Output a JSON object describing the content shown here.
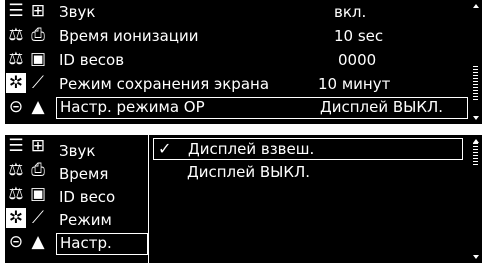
{
  "menu": {
    "items": [
      {
        "label": "Звук",
        "value": "вкл."
      },
      {
        "label": "Время ионизации",
        "value": "10 sec"
      },
      {
        "label": "ID  весов",
        "value": "0000"
      },
      {
        "label": "Режим сохранения экрана",
        "value": "10 минут"
      },
      {
        "label": "Настр. режима ОР",
        "value": "Дисплей ВЫКЛ."
      }
    ],
    "truncated_items": [
      "Звук",
      "Время",
      "ID  весо",
      "Режим",
      "Настр."
    ]
  },
  "popup": {
    "options": [
      {
        "check": "✓",
        "label": "Дисплей взвеш."
      },
      {
        "check": "",
        "label": "Дисплей ВЫКЛ."
      }
    ]
  },
  "sidebar": {
    "icons": [
      {
        "name": "list-icon",
        "glyph": "☰"
      },
      {
        "name": "app-save-icon",
        "glyph": "⊞"
      },
      {
        "name": "balance-scale-icon",
        "glyph": "⚖"
      },
      {
        "name": "print-icon",
        "glyph": "⎙"
      },
      {
        "name": "percent-weighing-icon",
        "glyph": "⚖"
      },
      {
        "name": "floppy-disk-icon",
        "glyph": "▣"
      },
      {
        "name": "settings-gear-icon",
        "glyph": "✲"
      },
      {
        "name": "statistics-chart-icon",
        "glyph": "⟋"
      },
      {
        "name": "calibration-icon",
        "glyph": "⊝"
      },
      {
        "name": "ionizer-icon",
        "glyph": "▲"
      }
    ]
  }
}
